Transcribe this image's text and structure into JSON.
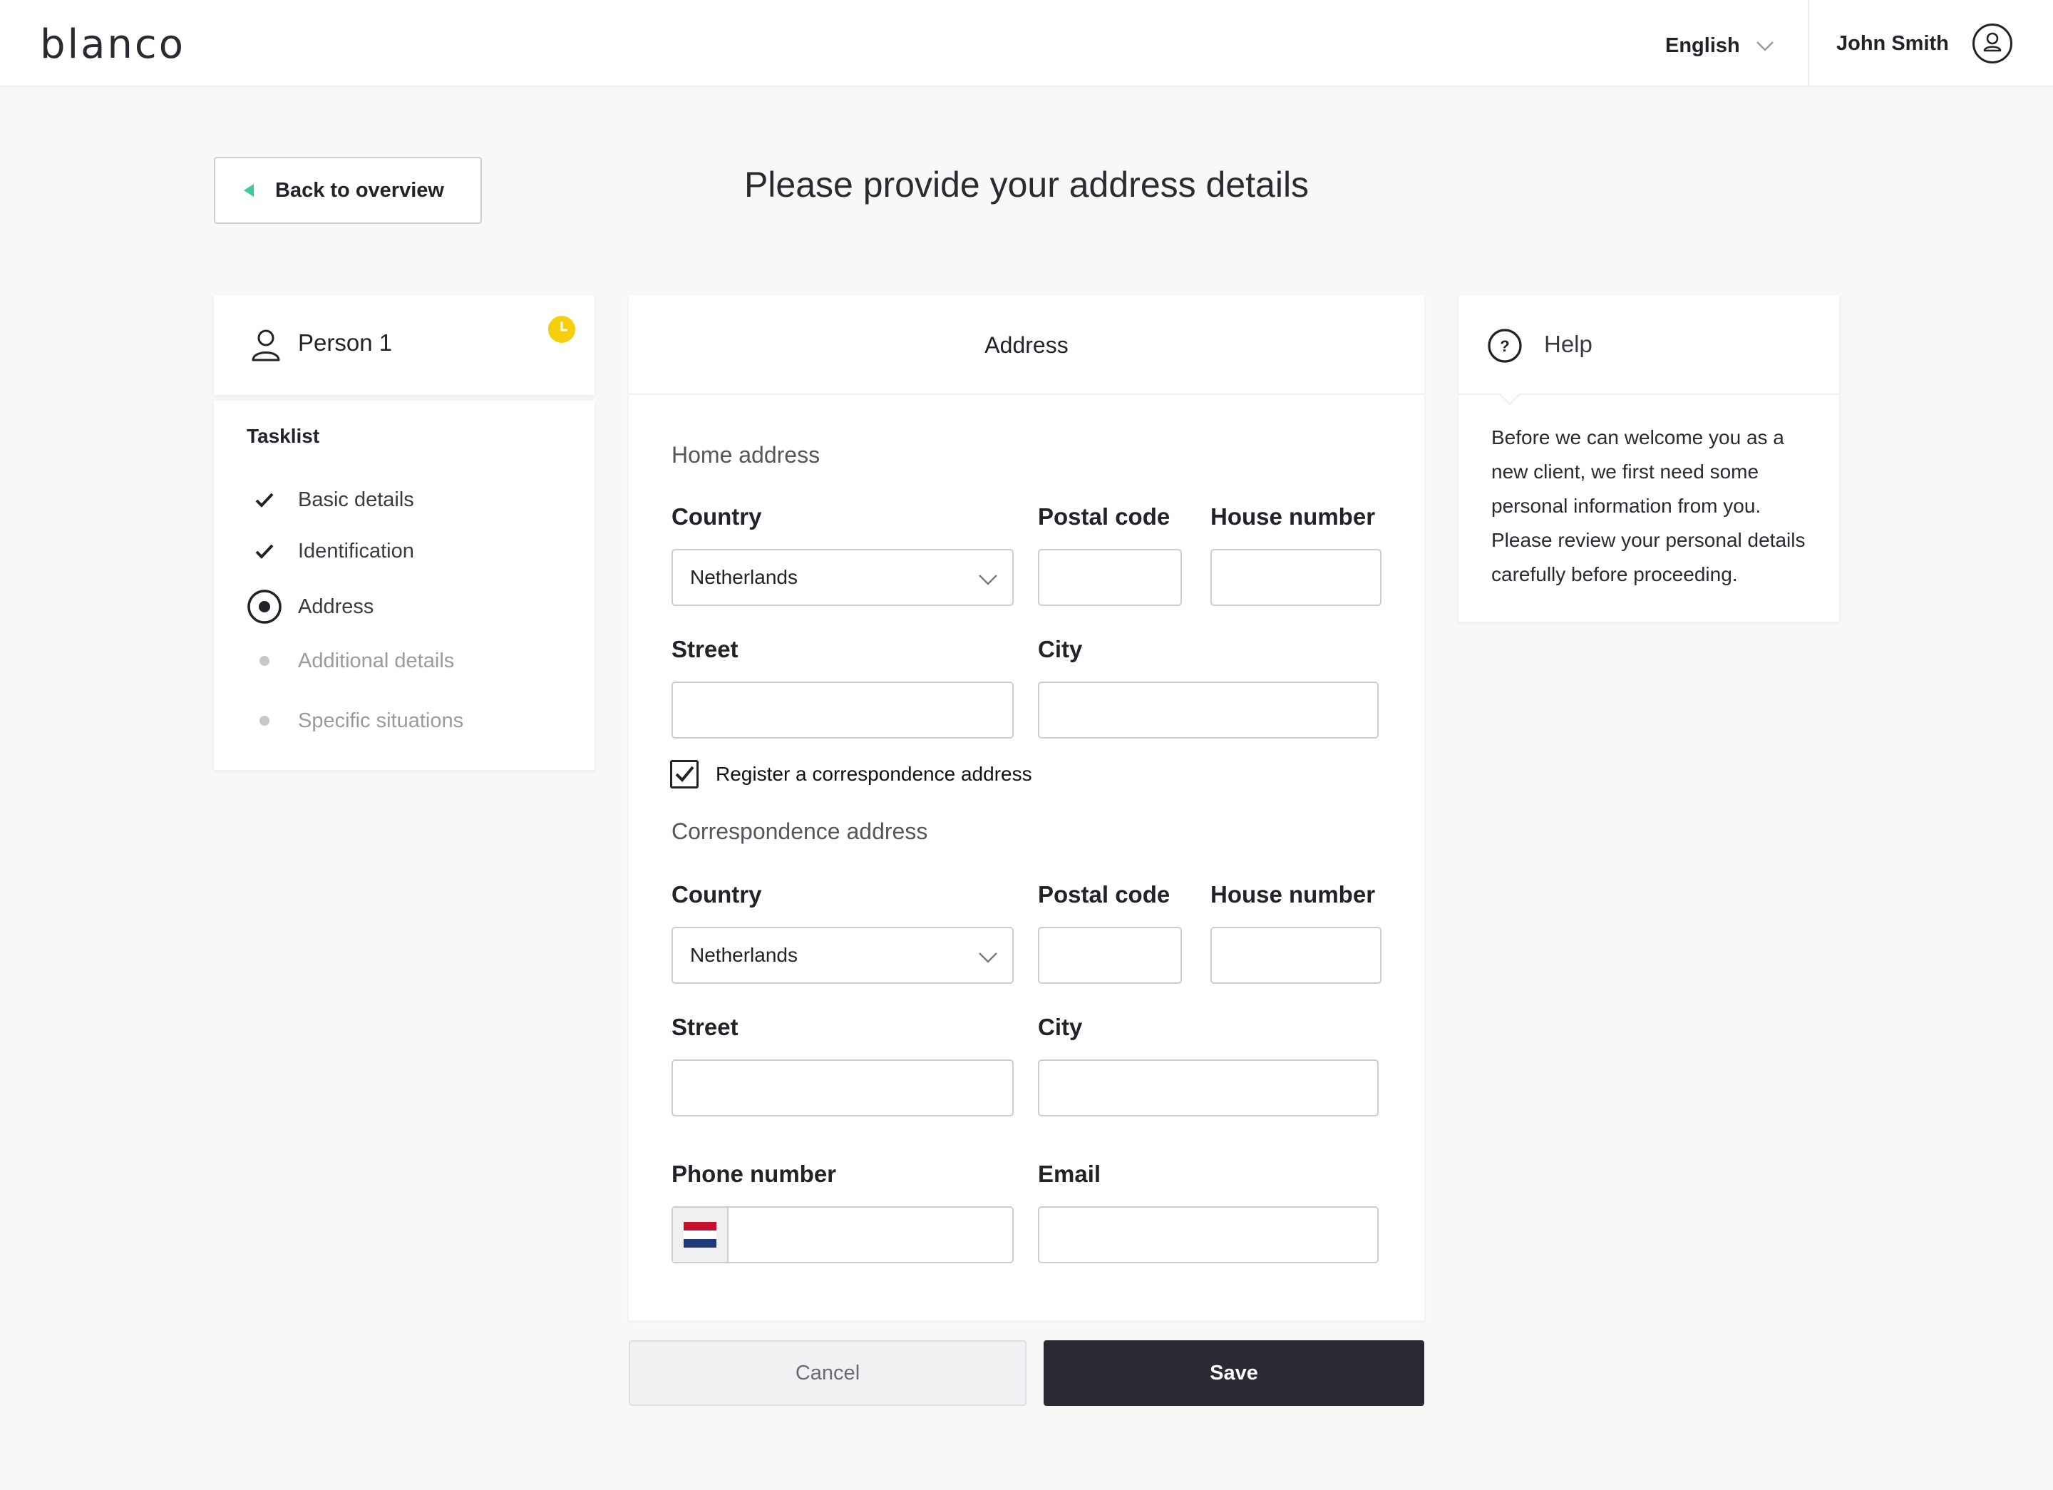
{
  "header": {
    "logo": "blanco",
    "language": "English",
    "user_name": "John Smith"
  },
  "page": {
    "back_label": "Back to overview",
    "title": "Please provide your address details"
  },
  "person": {
    "name": "Person 1",
    "status_icon": "clock-icon",
    "status_color": "#f5cf0c"
  },
  "tasklist": {
    "title": "Tasklist",
    "items": [
      {
        "label": "Basic details",
        "state": "done"
      },
      {
        "label": "Identification",
        "state": "done"
      },
      {
        "label": "Address",
        "state": "current"
      },
      {
        "label": "Additional details",
        "state": "pending"
      },
      {
        "label": "Specific situations",
        "state": "pending"
      }
    ]
  },
  "form": {
    "heading": "Address",
    "home": {
      "section_title": "Home address",
      "country_label": "Country",
      "country_value": "Netherlands",
      "postal_label": "Postal code",
      "postal_value": "",
      "house_label": "House number",
      "house_value": "",
      "street_label": "Street",
      "street_value": "",
      "city_label": "City",
      "city_value": ""
    },
    "correspondence_checkbox": {
      "label": "Register a correspondence address",
      "checked": true
    },
    "correspondence": {
      "section_title": "Correspondence address",
      "country_label": "Country",
      "country_value": "Netherlands",
      "postal_label": "Postal code",
      "postal_value": "",
      "house_label": "House number",
      "house_value": "",
      "street_label": "Street",
      "street_value": "",
      "city_label": "City",
      "city_value": ""
    },
    "phone_label": "Phone number",
    "phone_value": "",
    "phone_flag": "netherlands-flag",
    "email_label": "Email",
    "email_value": ""
  },
  "actions": {
    "cancel_label": "Cancel",
    "save_label": "Save"
  },
  "help": {
    "title": "Help",
    "text": "Before we can welcome you as a new client, we first need some personal information from you. Please review your personal details carefully before proceeding."
  },
  "colors": {
    "accent": "#3ec99c",
    "primary_button": "#2a2a33",
    "status_pending": "#f5cf0c",
    "background": "#f8f8f8"
  }
}
